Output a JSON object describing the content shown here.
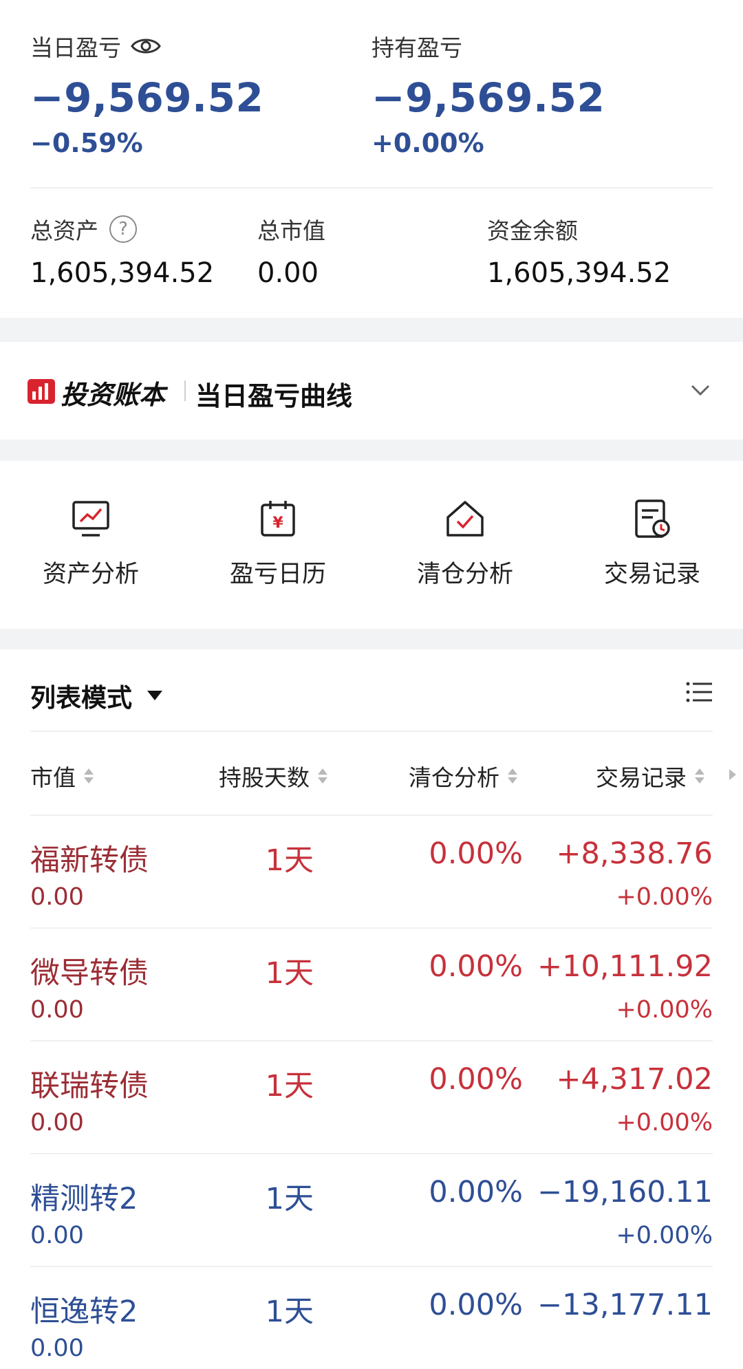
{
  "summary": {
    "daily_pl_label": "当日盈亏",
    "daily_pl_value": "−9,569.52",
    "daily_pl_pct": "−0.59%",
    "holding_pl_label": "持有盈亏",
    "holding_pl_value": "−9,569.52",
    "holding_pl_pct": "+0.00%",
    "total_assets_label": "总资产",
    "total_assets_value": "1,605,394.52",
    "market_value_label": "总市值",
    "market_value_value": "0.00",
    "cash_label": "资金余额",
    "cash_value": "1,605,394.52",
    "help_glyph": "?"
  },
  "ledger": {
    "brand": "投资账本",
    "title": "当日盈亏曲线"
  },
  "tools": [
    {
      "label": "资产分析",
      "icon": "monitor-chart-icon"
    },
    {
      "label": "盈亏日历",
      "icon": "calendar-yen-icon"
    },
    {
      "label": "清仓分析",
      "icon": "house-check-icon"
    },
    {
      "label": "交易记录",
      "icon": "document-clock-icon"
    }
  ],
  "list": {
    "mode_label": "列表模式",
    "columns": [
      "市值",
      "持股天数",
      "清仓分析",
      "交易记录"
    ],
    "rows": [
      {
        "name": "福新转债",
        "market_value": "0.00",
        "days": "1天",
        "clear_pct": "0.00%",
        "pl": "+8,338.76",
        "pl_pct": "+0.00%"
      },
      {
        "name": "微导转债",
        "market_value": "0.00",
        "days": "1天",
        "clear_pct": "0.00%",
        "pl": "+10,111.92",
        "pl_pct": "+0.00%"
      },
      {
        "name": "联瑞转债",
        "market_value": "0.00",
        "days": "1天",
        "clear_pct": "0.00%",
        "pl": "+4,317.02",
        "pl_pct": "+0.00%"
      },
      {
        "name": "精测转2",
        "market_value": "0.00",
        "days": "1天",
        "clear_pct": "0.00%",
        "pl": "−19,160.11",
        "pl_pct": "+0.00%"
      },
      {
        "name": "恒逸转2",
        "market_value": "0.00",
        "days": "1天",
        "clear_pct": "0.00%",
        "pl": "−13,177.11",
        "pl_pct": ""
      }
    ]
  },
  "colors": {
    "gain": "#c7313b",
    "loss": "#2e4f95"
  }
}
